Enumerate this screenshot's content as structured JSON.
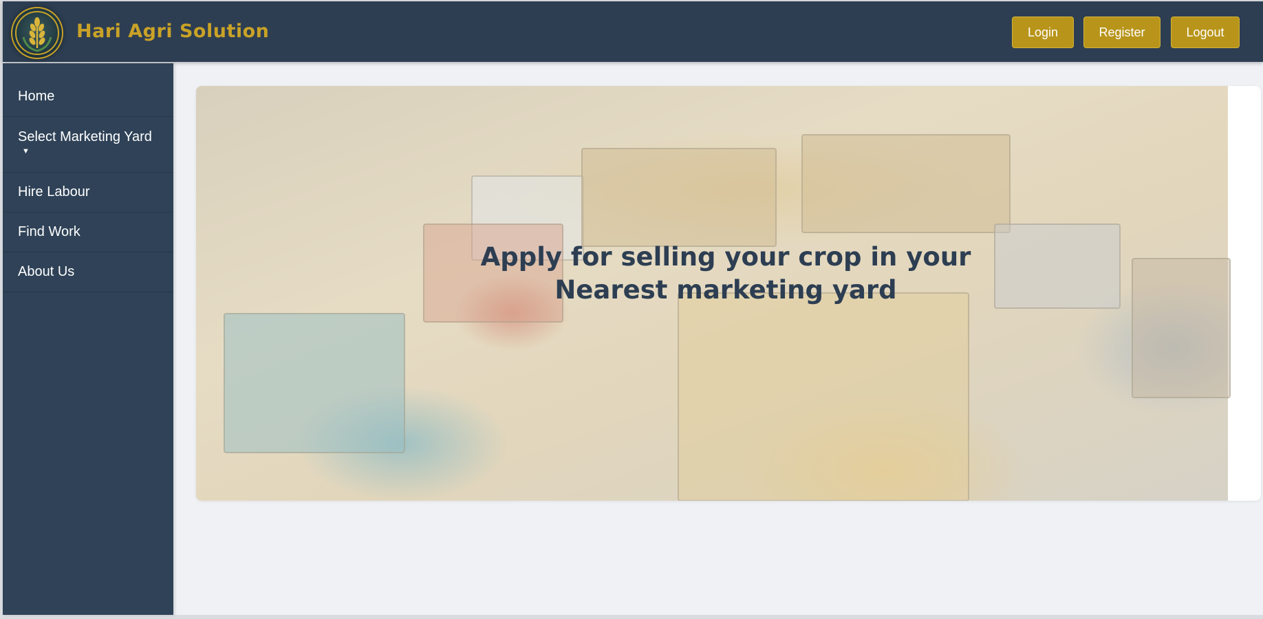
{
  "header": {
    "brand_name": "Hari Agri Solution",
    "logo_icon": "wheat-emblem-icon",
    "buttons": {
      "login": "Login",
      "register": "Register",
      "logout": "Logout"
    }
  },
  "sidebar": {
    "items": [
      {
        "label": "Home"
      },
      {
        "label": "Select Marketing Yard",
        "caret": "▼"
      },
      {
        "label": "Hire Labour"
      },
      {
        "label": "Find Work"
      },
      {
        "label": "About Us"
      }
    ]
  },
  "hero": {
    "title": "Apply for selling your crop in your Nearest marketing yard"
  },
  "colors": {
    "header_bg": "#2d3e52",
    "sidebar_bg": "#2f4257",
    "accent_gold": "#b8951a",
    "brand_text": "#c9a227",
    "page_bg": "#eff1f5"
  }
}
